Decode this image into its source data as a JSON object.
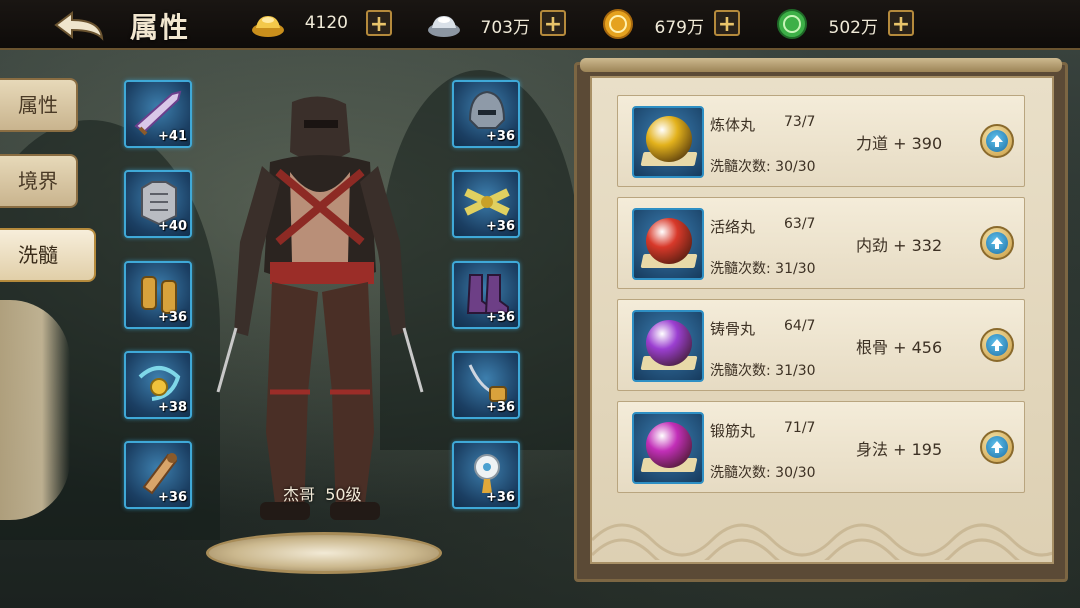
{
  "header": {
    "title": "属性",
    "resources": [
      {
        "icon": "gold-ingot-icon",
        "value": "4120"
      },
      {
        "icon": "silver-ingot-icon",
        "value": "703万"
      },
      {
        "icon": "copper-coin-icon",
        "value": "679万"
      },
      {
        "icon": "jade-coin-icon",
        "value": "502万"
      }
    ]
  },
  "tabs": [
    {
      "label": "属性",
      "active": false
    },
    {
      "label": "境界",
      "active": false
    },
    {
      "label": "洗髓",
      "active": true
    }
  ],
  "equipment": {
    "left": [
      {
        "icon": "sword-icon",
        "level": "+41"
      },
      {
        "icon": "armor-icon",
        "level": "+40"
      },
      {
        "icon": "bracers-icon",
        "level": "+36"
      },
      {
        "icon": "amulet-icon",
        "level": "+38"
      },
      {
        "icon": "scroll-icon",
        "level": "+36"
      }
    ],
    "right": [
      {
        "icon": "helmet-icon",
        "level": "+36"
      },
      {
        "icon": "belt-icon",
        "level": "+36"
      },
      {
        "icon": "boots-icon",
        "level": "+36"
      },
      {
        "icon": "pendant-icon",
        "level": "+36"
      },
      {
        "icon": "jade-ornament-icon",
        "level": "+36"
      }
    ]
  },
  "character": {
    "name": "杰哥",
    "level": "50级"
  },
  "refine_rows": [
    {
      "pill": "炼体丸",
      "count": "73/7",
      "refine": "洗髓次数: 30/30",
      "bonus": "力道 + 390",
      "color": "#e3b21c"
    },
    {
      "pill": "活络丸",
      "count": "63/7",
      "refine": "洗髓次数: 31/30",
      "bonus": "内劲 + 332",
      "color": "#d8392a"
    },
    {
      "pill": "铸骨丸",
      "count": "64/7",
      "refine": "洗髓次数: 31/30",
      "bonus": "根骨 + 456",
      "color": "#9b3fd1"
    },
    {
      "pill": "锻筋丸",
      "count": "71/7",
      "refine": "洗髓次数: 30/30",
      "bonus": "身法 + 195",
      "color": "#c22fb8"
    }
  ]
}
